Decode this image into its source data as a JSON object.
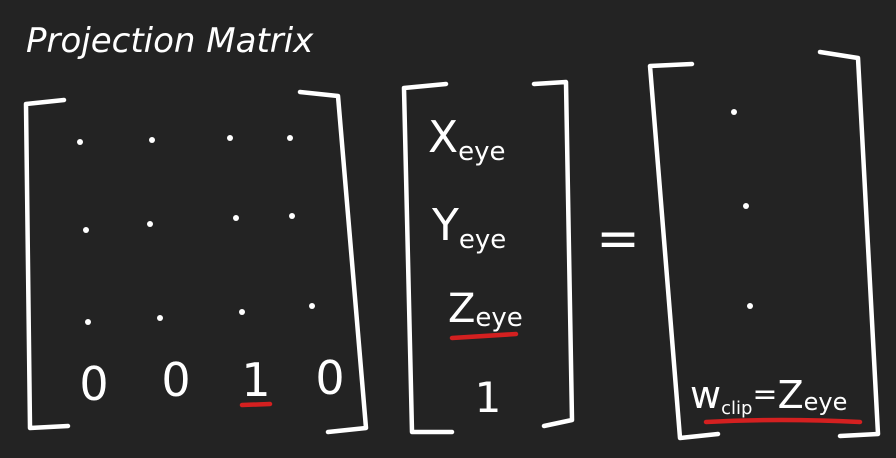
{
  "title": "Projection Matrix",
  "matrix": {
    "placeholder_rows": 3,
    "placeholder_cols": 4,
    "bottom_row": [
      "0",
      "0",
      "1",
      "0"
    ],
    "highlighted_index": 2
  },
  "vector": {
    "entries": [
      {
        "main": "X",
        "sub": "eye"
      },
      {
        "main": "Y",
        "sub": "eye"
      },
      {
        "main": "Z",
        "sub": "eye"
      },
      {
        "main": "1",
        "sub": ""
      }
    ],
    "highlighted_index": 2
  },
  "equals": "=",
  "result": {
    "placeholder_rows": 3,
    "last": {
      "lhs_main": "w",
      "lhs_sub": "clip",
      "eq": "=",
      "rhs_main": "Z",
      "rhs_sub": "eye"
    }
  },
  "colors": {
    "background": "#232323",
    "ink": "#ffffff",
    "highlight": "#d42020"
  }
}
